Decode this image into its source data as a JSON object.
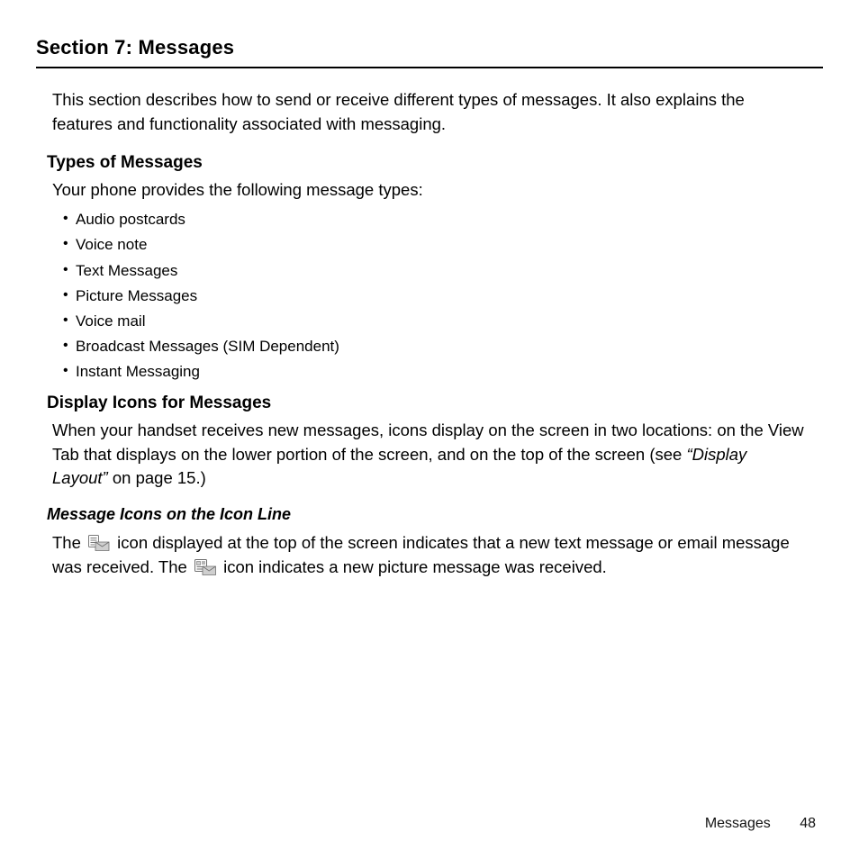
{
  "section_title": "Section 7: Messages",
  "intro": "This section describes how to send or receive different types of messages. It also explains the features and functionality associated with messaging.",
  "types": {
    "heading": "Types of Messages",
    "lead": "Your phone provides the following message types:",
    "items": [
      "Audio postcards",
      "Voice note",
      "Text Messages",
      "Picture Messages",
      "Voice mail",
      "Broadcast Messages (SIM Dependent)",
      "Instant Messaging"
    ]
  },
  "display_icons": {
    "heading": "Display Icons for Messages",
    "para_pre": "When your handset receives new messages, icons display on the screen in two locations: on the View Tab that displays on the lower portion of the screen, and on the top of the screen (see ",
    "para_ref": "“Display Layout”",
    "para_post": " on page 15.)"
  },
  "icon_line": {
    "heading": "Message Icons on the Icon Line",
    "p1_a": "The ",
    "p1_b": " icon displayed at the top of the screen indicates that a new text message or email message was received. The ",
    "p1_c": " icon indicates a new picture message was received."
  },
  "footer": {
    "label": "Messages",
    "page": "48"
  }
}
